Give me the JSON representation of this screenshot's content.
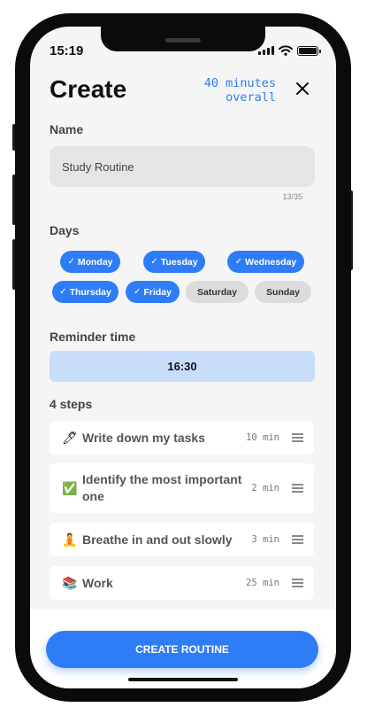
{
  "status_bar": {
    "time": "15:19"
  },
  "header": {
    "title": "Create",
    "overall_line1": "40 minutes",
    "overall_line2": "overall"
  },
  "name_section": {
    "label": "Name",
    "value": "Study Routine",
    "counter": "13/35"
  },
  "days_section": {
    "label": "Days",
    "days": [
      {
        "label": "Monday",
        "selected": true
      },
      {
        "label": "Tuesday",
        "selected": true
      },
      {
        "label": "Wednesday",
        "selected": true
      },
      {
        "label": "Thursday",
        "selected": true
      },
      {
        "label": "Friday",
        "selected": true
      },
      {
        "label": "Saturday",
        "selected": false
      },
      {
        "label": "Sunday",
        "selected": false
      }
    ],
    "check_glyph": "✓"
  },
  "reminder_section": {
    "label": "Reminder time",
    "time": "16:30"
  },
  "steps_section": {
    "label": "4 steps",
    "steps": [
      {
        "emoji": "🖊",
        "text": "Write down my tasks",
        "duration": "10 min"
      },
      {
        "emoji": "✅",
        "text": "Identify the most important one",
        "duration": "2 min"
      },
      {
        "emoji": "🧘",
        "text": "Breathe in and out slowly",
        "duration": "3 min"
      },
      {
        "emoji": "📚",
        "text": "Work",
        "duration": "25 min"
      }
    ]
  },
  "cta": {
    "label": "CREATE ROUTINE"
  },
  "colors": {
    "accent": "#2f7df6",
    "accent_light": "#c8ddfa",
    "chip_off": "#dcdcdc",
    "background": "#f5f5f5"
  }
}
